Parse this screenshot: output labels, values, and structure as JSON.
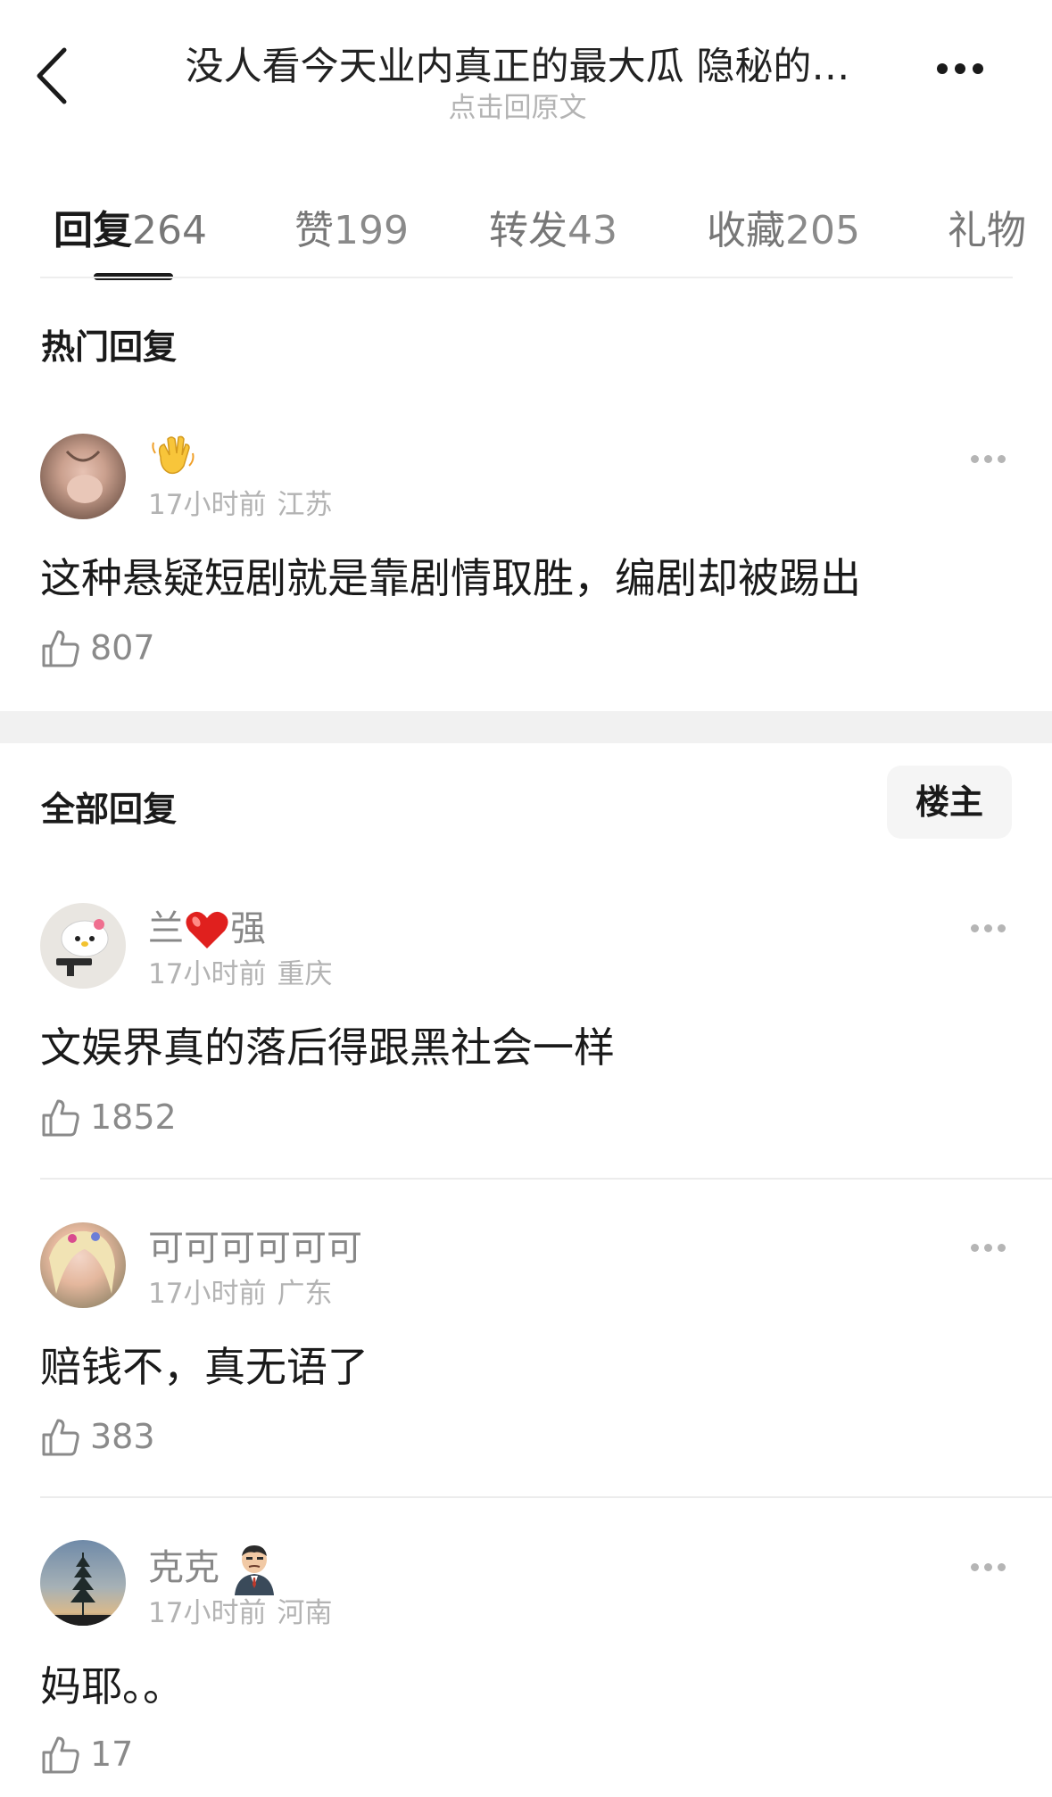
{
  "header": {
    "title": "没人看今天业内真正的最大瓜  隐秘的…",
    "subtitle": "点击回原文"
  },
  "tabs": [
    {
      "label": "回复",
      "count": "264"
    },
    {
      "label": "赞",
      "count": "199"
    },
    {
      "label": "转发",
      "count": "43"
    },
    {
      "label": "收藏",
      "count": "205"
    },
    {
      "label": "礼物",
      "count": ""
    }
  ],
  "hot_section": {
    "title": "热门回复",
    "comments": [
      {
        "username_emoji": "waving-hand",
        "time": "17小时前",
        "location": "江苏",
        "text": "这种悬疑短剧就是靠剧情取胜，编剧却被踢出",
        "likes": "807"
      }
    ]
  },
  "all_section": {
    "title": "全部回复",
    "filter_label": "楼主",
    "comments": [
      {
        "username_a": "兰",
        "username_heart": "red-heart",
        "username_b": "强",
        "time": "17小时前",
        "location": "重庆",
        "text": "文娱界真的落后得跟黑社会一样",
        "likes": "1852"
      },
      {
        "username": "可可可可可可",
        "time": "17小时前",
        "location": "广东",
        "text": "赔钱不，真无语了",
        "likes": "383"
      },
      {
        "username": "克克",
        "username_sticker": "man-in-suit",
        "time": "17小时前",
        "location": "河南",
        "text": "妈耶。。",
        "likes": "17"
      }
    ]
  }
}
